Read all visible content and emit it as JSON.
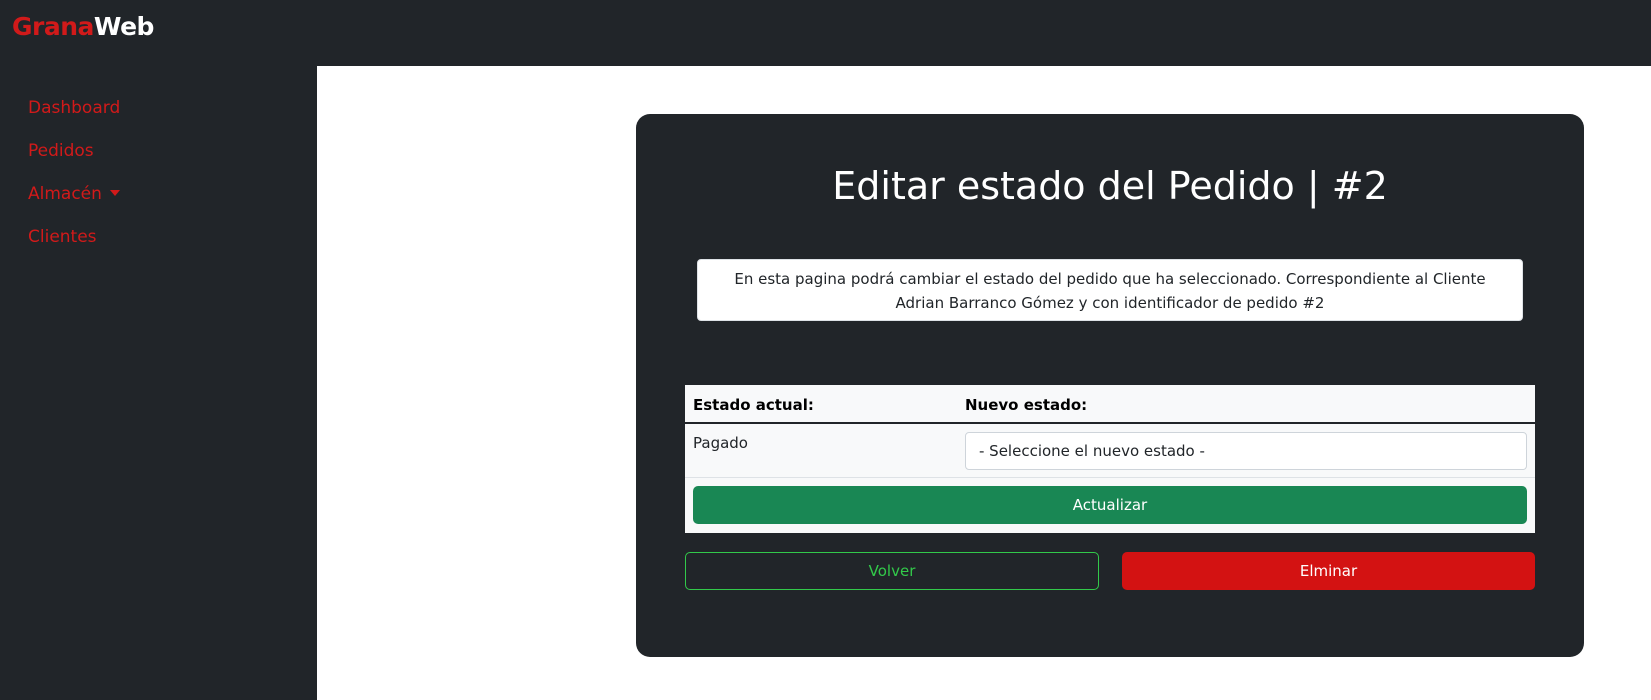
{
  "brand": {
    "part1": "Grana",
    "part2": "Web"
  },
  "sidebar": {
    "items": [
      {
        "label": "Dashboard"
      },
      {
        "label": "Pedidos"
      },
      {
        "label": "Almacén",
        "has_dropdown": true
      },
      {
        "label": "Clientes"
      }
    ]
  },
  "card": {
    "title": "Editar estado del Pedido | #2",
    "info": "En esta pagina podrá cambiar el estado del pedido que ha seleccionado. Correspondiente al Cliente Adrian Barranco Gómez y con identificador de pedido #2",
    "table": {
      "header_current": "Estado actual:",
      "header_new": "Nuevo estado:",
      "current_value": "Pagado",
      "select_value": "- Seleccione el nuevo estado -"
    },
    "update_label": "Actualizar",
    "back_label": "Volver",
    "delete_label": "Elminar"
  },
  "colors": {
    "brand_red": "#d11a1a",
    "dark": "#212529",
    "success": "#198754",
    "back_outline": "#32c94a",
    "danger": "#d31212"
  }
}
